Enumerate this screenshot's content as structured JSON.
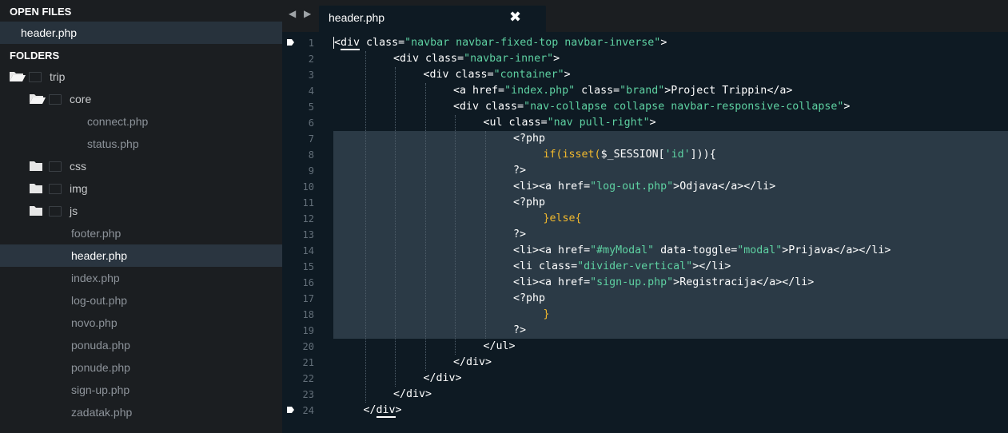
{
  "sidebar": {
    "open_files_header": "OPEN FILES",
    "open_files": [
      "header.php"
    ],
    "folders_header": "FOLDERS",
    "tree": [
      {
        "name": "trip",
        "kind": "folder-open",
        "depth": 0
      },
      {
        "name": "core",
        "kind": "folder-open",
        "depth": 1
      },
      {
        "name": "connect.php",
        "kind": "file",
        "depth": 2
      },
      {
        "name": "status.php",
        "kind": "file",
        "depth": 2
      },
      {
        "name": "css",
        "kind": "folder-closed",
        "depth": 1
      },
      {
        "name": "img",
        "kind": "folder-closed",
        "depth": 1
      },
      {
        "name": "js",
        "kind": "folder-closed",
        "depth": 1
      },
      {
        "name": "footer.php",
        "kind": "file",
        "depth": 1
      },
      {
        "name": "header.php",
        "kind": "file",
        "depth": 1,
        "selected": true
      },
      {
        "name": "index.php",
        "kind": "file",
        "depth": 1
      },
      {
        "name": "log-out.php",
        "kind": "file",
        "depth": 1
      },
      {
        "name": "novo.php",
        "kind": "file",
        "depth": 1
      },
      {
        "name": "ponuda.php",
        "kind": "file",
        "depth": 1
      },
      {
        "name": "ponude.php",
        "kind": "file",
        "depth": 1
      },
      {
        "name": "sign-up.php",
        "kind": "file",
        "depth": 1
      },
      {
        "name": "zadatak.php",
        "kind": "file",
        "depth": 1
      }
    ]
  },
  "tabbar": {
    "nav_arrows": "◀ ▶",
    "active_tab": "header.php",
    "close_glyph": "✖"
  },
  "editor": {
    "line_numbers": [
      "1",
      "2",
      "3",
      "4",
      "5",
      "6",
      "7",
      "8",
      "9",
      "10",
      "11",
      "12",
      "13",
      "14",
      "15",
      "16",
      "17",
      "18",
      "19",
      "20",
      "21",
      "22",
      "23",
      "24"
    ],
    "bookmarked_lines": [
      1,
      24
    ],
    "highlighted_lines": [
      7,
      19
    ],
    "lines": [
      {
        "indent": 0,
        "tokens": [
          [
            "tag",
            "<"
          ],
          [
            "tag_ul",
            "div"
          ],
          [
            "attr",
            " class="
          ],
          [
            "str",
            "\"navbar navbar-fixed-top navbar-inverse\""
          ],
          [
            "tag",
            ">"
          ]
        ]
      },
      {
        "indent": 2,
        "tokens": [
          [
            "tag",
            "<div"
          ],
          [
            "attr",
            " class="
          ],
          [
            "str",
            "\"navbar-inner\""
          ],
          [
            "tag",
            ">"
          ]
        ]
      },
      {
        "indent": 3,
        "tokens": [
          [
            "tag",
            "<div"
          ],
          [
            "attr",
            " class="
          ],
          [
            "str",
            "\"container\""
          ],
          [
            "tag",
            ">"
          ]
        ]
      },
      {
        "indent": 4,
        "tokens": [
          [
            "tag",
            "<a"
          ],
          [
            "attr",
            " href="
          ],
          [
            "str",
            "\"index.php\""
          ],
          [
            "attr",
            " class="
          ],
          [
            "str",
            "\"brand\""
          ],
          [
            "tag",
            ">"
          ],
          [
            "txt",
            "Project Trippin"
          ],
          [
            "tag",
            "</a>"
          ]
        ]
      },
      {
        "indent": 4,
        "tokens": [
          [
            "tag",
            "<div"
          ],
          [
            "attr",
            " class="
          ],
          [
            "str",
            "\"nav-collapse collapse navbar-responsive-collapse\""
          ],
          [
            "tag",
            ">"
          ]
        ]
      },
      {
        "indent": 5,
        "tokens": [
          [
            "tag",
            "<ul"
          ],
          [
            "attr",
            " class="
          ],
          [
            "str",
            "\"nav pull-right\""
          ],
          [
            "tag",
            ">"
          ]
        ]
      },
      {
        "indent": 6,
        "tokens": [
          [
            "php",
            "<?php"
          ]
        ]
      },
      {
        "indent": 7,
        "tokens": [
          [
            "kw",
            "if("
          ],
          [
            "kw",
            "isset("
          ],
          [
            "php",
            "$_SESSION["
          ],
          [
            "str",
            "'id'"
          ],
          [
            "php",
            "])){"
          ]
        ]
      },
      {
        "indent": 6,
        "tokens": [
          [
            "php",
            "?>"
          ]
        ]
      },
      {
        "indent": 6,
        "tokens": [
          [
            "tag",
            "<li><a"
          ],
          [
            "attr",
            " href="
          ],
          [
            "str",
            "\"log-out.php\""
          ],
          [
            "tag",
            ">"
          ],
          [
            "txt",
            "Odjava"
          ],
          [
            "tag",
            "</a></li>"
          ]
        ]
      },
      {
        "indent": 6,
        "tokens": [
          [
            "php",
            "<?php"
          ]
        ]
      },
      {
        "indent": 7,
        "tokens": [
          [
            "kw",
            "}else{"
          ]
        ]
      },
      {
        "indent": 6,
        "tokens": [
          [
            "php",
            "?>"
          ]
        ]
      },
      {
        "indent": 6,
        "tokens": [
          [
            "tag",
            "<li><a"
          ],
          [
            "attr",
            " href="
          ],
          [
            "str",
            "\"#myModal\""
          ],
          [
            "attr",
            " data-toggle="
          ],
          [
            "str",
            "\"modal\""
          ],
          [
            "tag",
            ">"
          ],
          [
            "txt",
            "Prijava"
          ],
          [
            "tag",
            "</a></li>"
          ]
        ]
      },
      {
        "indent": 6,
        "tokens": [
          [
            "tag",
            "<li"
          ],
          [
            "attr",
            " class="
          ],
          [
            "str",
            "\"divider-vertical\""
          ],
          [
            "tag",
            "></li>"
          ]
        ]
      },
      {
        "indent": 6,
        "tokens": [
          [
            "tag",
            "<li><a"
          ],
          [
            "attr",
            " href="
          ],
          [
            "str",
            "\"sign-up.php\""
          ],
          [
            "tag",
            ">"
          ],
          [
            "txt",
            "Registracija"
          ],
          [
            "tag",
            "</a></li>"
          ]
        ]
      },
      {
        "indent": 6,
        "tokens": [
          [
            "php",
            "<?php"
          ]
        ]
      },
      {
        "indent": 7,
        "tokens": [
          [
            "kw",
            "}"
          ]
        ]
      },
      {
        "indent": 6,
        "tokens": [
          [
            "php",
            "?>"
          ]
        ]
      },
      {
        "indent": 5,
        "tokens": [
          [
            "tag",
            "</ul>"
          ]
        ]
      },
      {
        "indent": 4,
        "tokens": [
          [
            "tag",
            "</div>"
          ]
        ]
      },
      {
        "indent": 3,
        "tokens": [
          [
            "tag",
            "</div>"
          ]
        ]
      },
      {
        "indent": 2,
        "tokens": [
          [
            "tag",
            "</div>"
          ]
        ]
      },
      {
        "indent": 1,
        "tokens": [
          [
            "tag",
            "</"
          ],
          [
            "tag_ul",
            "div"
          ],
          [
            "tag",
            ">"
          ]
        ]
      }
    ]
  },
  "colors": {
    "sidebar_bg": "#1b1e21",
    "editor_bg": "#0e1a23",
    "selection_bg": "#2b3a46",
    "string": "#5ed1a2",
    "keyword": "#f2b92d",
    "line_number": "#636f79"
  }
}
